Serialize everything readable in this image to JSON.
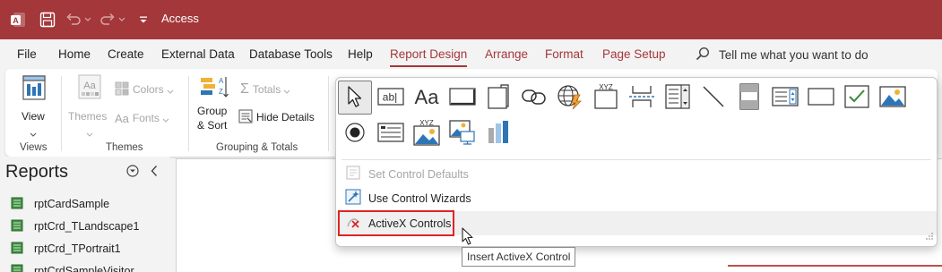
{
  "window": {
    "title": "Access"
  },
  "quick_access": {
    "app_icon": "access-logo",
    "save_icon": "save-icon",
    "undo_icon": "undo-icon",
    "redo_icon": "redo-icon",
    "customize_icon": "customize-qat-icon"
  },
  "colors": {
    "accent": "#a4373a",
    "highlight_box": "#e02424",
    "check": "#3a8a3a"
  },
  "menu": {
    "tabs": [
      {
        "label": "File"
      },
      {
        "label": "Home"
      },
      {
        "label": "Create"
      },
      {
        "label": "External Data"
      },
      {
        "label": "Database Tools"
      },
      {
        "label": "Help"
      },
      {
        "label": "Report Design",
        "active": true
      },
      {
        "label": "Arrange"
      },
      {
        "label": "Format"
      },
      {
        "label": "Page Setup"
      }
    ],
    "tell_me": "Tell me what you want to do"
  },
  "ribbon": {
    "views": {
      "view_label": "View",
      "group_label": "Views"
    },
    "themes": {
      "themes_label": "Themes",
      "colors_label": "Colors",
      "fonts_label": "Fonts",
      "group_label": "Themes"
    },
    "grouping": {
      "group_sort_line1": "Group",
      "group_sort_line2": "& Sort",
      "totals_label": "Totals",
      "hide_details_label": "Hide Details",
      "group_label": "Grouping & Totals"
    }
  },
  "controls_menu": {
    "row1_icons": [
      "select-pointer-icon",
      "text-box-icon",
      "label-icon",
      "button-icon",
      "tab-control-icon",
      "attachment-link-icon",
      "hyperlink-globe-icon",
      "navigation-control-icon",
      "page-break-icon",
      "combo-box-icon",
      "line-icon",
      "subform-icon",
      "list-box-icon",
      "rectangle-icon",
      "check-box-icon",
      "image-icon"
    ],
    "row2_icons": [
      "option-button-icon",
      "bound-object-frame-icon",
      "chart-icon",
      "unbound-object-frame-icon",
      "insert-chart-icon"
    ],
    "xyz_text": "XYZ",
    "ab_text": "ab|",
    "aa_text": "Aa",
    "set_defaults": "Set Control Defaults",
    "use_wizards": "Use Control Wizards",
    "activex": "ActiveX Controls"
  },
  "tooltip": "Insert ActiveX Control",
  "nav": {
    "title": "Reports",
    "items": [
      {
        "label": "rptCardSample"
      },
      {
        "label": "rptCrd_TLandscape1"
      },
      {
        "label": "rptCrd_TPortrait1"
      },
      {
        "label": "rptCrdSampleVisitor"
      }
    ]
  }
}
